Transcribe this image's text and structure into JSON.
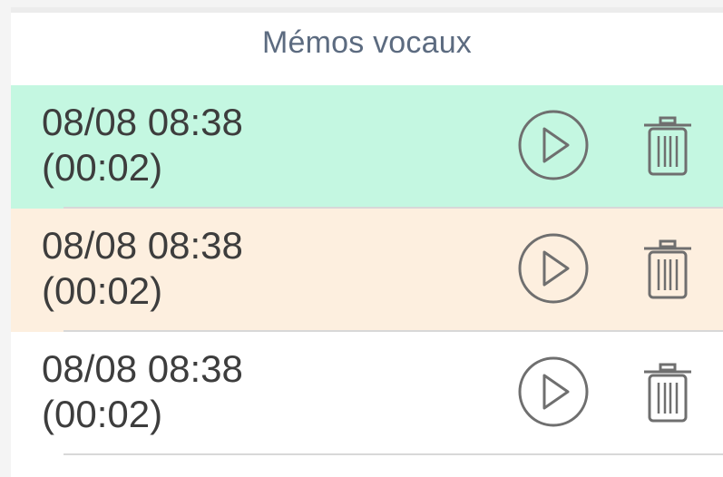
{
  "header": {
    "title": "Mémos vocaux"
  },
  "memos": [
    {
      "date": "08/08 08:38",
      "duration": "(00:02)",
      "background": "#c4f7e1"
    },
    {
      "date": "08/08 08:38",
      "duration": "(00:02)",
      "background": "#fdefdf"
    },
    {
      "date": "08/08 08:38",
      "duration": "(00:02)",
      "background": "#ffffff"
    }
  ],
  "icons": {
    "play": "play-circle-icon",
    "delete": "trash-icon"
  },
  "colors": {
    "title": "#5c6b80",
    "text": "#3d3d3d",
    "icon": "#6f6f6f"
  }
}
